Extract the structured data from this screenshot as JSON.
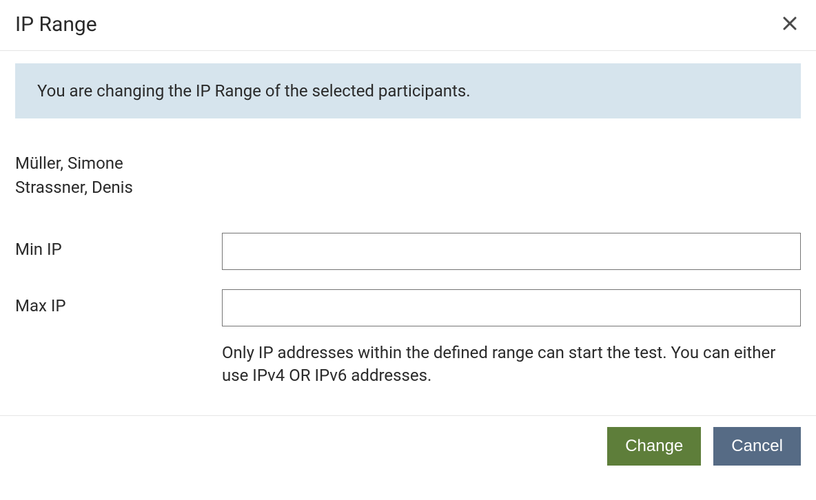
{
  "header": {
    "title": "IP Range"
  },
  "info": {
    "message": "You are changing the IP Range of the selected participants."
  },
  "participants": [
    "Müller, Simone",
    "Strassner, Denis"
  ],
  "form": {
    "min_ip": {
      "label": "Min IP",
      "value": ""
    },
    "max_ip": {
      "label": "Max IP",
      "value": ""
    },
    "help_text": "Only IP addresses within the defined range can start the test. You can either use IPv4 OR IPv6 addresses."
  },
  "footer": {
    "change_label": "Change",
    "cancel_label": "Cancel"
  }
}
